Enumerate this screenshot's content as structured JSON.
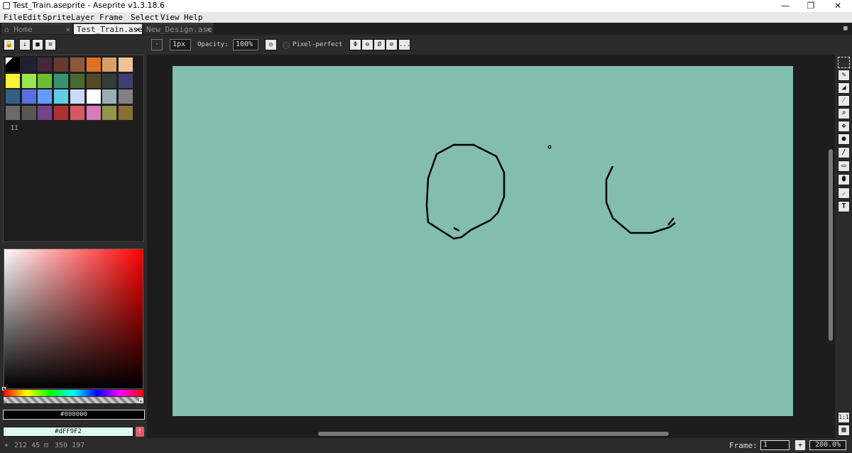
{
  "window": {
    "title": "Test_Train.aseprite - Aseprite v1.3.18.6",
    "minimize": "—",
    "maximize": "❐",
    "close": "✕"
  },
  "menu": [
    "File",
    "Edit",
    "Sprite",
    "Layer",
    "Frame",
    "Select",
    "View",
    "Help"
  ],
  "tabs": [
    {
      "label": "Home",
      "icon": "home-icon",
      "active": false
    },
    {
      "label": "Test_Train.ase",
      "active": true
    },
    {
      "label": "New_Design.ase",
      "active": false
    }
  ],
  "tab_close": "✕",
  "context_bar": {
    "brush_size": "1px",
    "opacity_label": "Opacity:",
    "opacity_value": "100%",
    "pixel_perfect_label": "Pixel-perfect",
    "more_symbol": "...",
    "symmetry_icons": [
      "symmetry-horizontal-icon",
      "symmetry-vertical-icon",
      "symmetry-both-icon",
      "symmetry-off-icon"
    ]
  },
  "palette": {
    "colors": [
      "#000000",
      "#222034",
      "#45283c",
      "#663931",
      "#8f563b",
      "#df7126",
      "#d9a066",
      "#eec39a",
      "#fbf236",
      "#99e550",
      "#6abe30",
      "#37946e",
      "#4b692f",
      "#524b24",
      "#323c39",
      "#3f3f74",
      "#306082",
      "#5b6ee1",
      "#639bff",
      "#5fcde4",
      "#cbdbfc",
      "#ffffff",
      "#9badb7",
      "#847e87",
      "#696a6a",
      "#595652",
      "#76428a",
      "#ac3232",
      "#d95763",
      "#d77bba",
      "#8f974a",
      "#8a6f30"
    ],
    "pause_symbol": "II"
  },
  "colors": {
    "foreground_hex": "#000000",
    "background_hex": "#dFF9F2",
    "canvas_bg": "#82bdb0",
    "warning_badge": "!"
  },
  "status": {
    "cursor_pos": "212 45",
    "sprite_size": "350 197",
    "frame_label": "Frame:",
    "frame_value": "1",
    "zoom": "200.0%",
    "one_to_one": "1:1"
  },
  "tools": [
    "rectangular-marquee-icon",
    "pencil-icon",
    "eraser-icon",
    "eyedropper-icon",
    "zoom-icon",
    "move-icon",
    "paint-bucket-icon",
    "line-icon",
    "rectangle-icon",
    "blur-icon",
    "contour-icon",
    "text-tool-icon"
  ]
}
